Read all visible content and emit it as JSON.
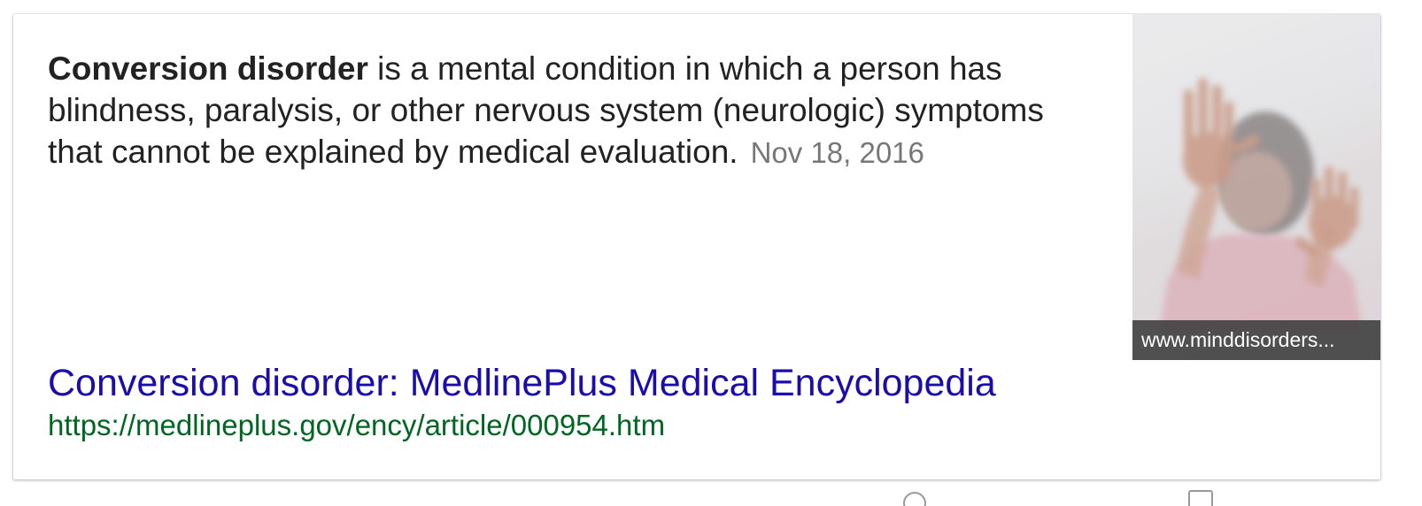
{
  "snippet": {
    "bold_term": "Conversion disorder",
    "text": " is a mental condition in which a person has blindness, paralysis, or other nervous system (neurologic) symptoms that cannot be explained by medical evaluation.",
    "date": "Nov 18, 2016"
  },
  "thumbnail": {
    "caption": "www.minddisorders..."
  },
  "result": {
    "title": "Conversion disorder: MedlinePlus Medical Encyclopedia",
    "url": "https://medlineplus.gov/ency/article/000954.htm"
  },
  "colors": {
    "link": "#1a0dab",
    "url": "#006621",
    "date": "#777777",
    "text": "#222222"
  }
}
